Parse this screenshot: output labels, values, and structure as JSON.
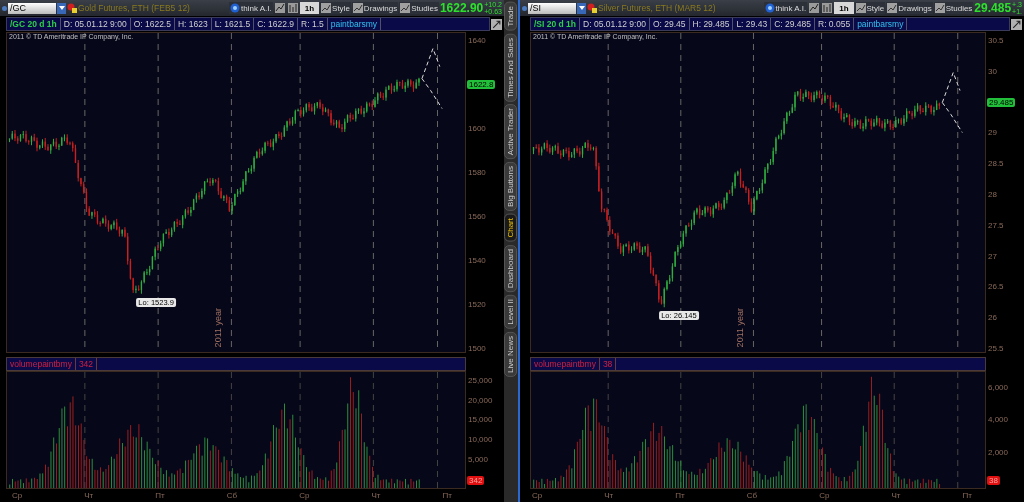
{
  "panels": [
    {
      "symbol": "/GC",
      "description": "Gold Futures, ETH (FEB5 12)",
      "think_ai": "think A.I.",
      "interval": "1h",
      "buttons": [
        "Style",
        "Drawings",
        "Studies"
      ],
      "last_price": "1622.90",
      "change": [
        "+10.2",
        "+0.63"
      ],
      "info": {
        "title": "/GC 20 d 1h",
        "cells": [
          "D: 05.01.12 9:00",
          "O: 1622.5",
          "H: 1623",
          "L: 1621.5",
          "C: 1622.9",
          "R: 1.5"
        ],
        "study": "paintbarsmy"
      },
      "copyright": "2011 © TD Ameritrade IP Company, Inc.",
      "price_axis": [
        {
          "kind": "tick",
          "label": "1640"
        },
        {
          "kind": "badge",
          "label": "1622.8"
        },
        {
          "kind": "tick",
          "label": "1600"
        },
        {
          "kind": "tick",
          "label": "1580"
        },
        {
          "kind": "tick",
          "label": "1560"
        },
        {
          "kind": "tick",
          "label": "1540"
        },
        {
          "kind": "tick",
          "label": "1520"
        },
        {
          "kind": "tick",
          "label": "1500"
        }
      ],
      "low_label": "Lo: 1523.9",
      "year_label": "2011 year",
      "volume": {
        "label": "volumepaintbmy",
        "value": "342",
        "ticks": [
          "25,000",
          "20,000",
          "15,000",
          "10,000",
          "5,000"
        ],
        "badge": "342"
      },
      "x_labels": [
        "Ср",
        "Чт",
        "Пт",
        "Сб",
        "Ср",
        "Чт",
        "Пт"
      ]
    },
    {
      "symbol": "/SI",
      "description": "Silver Futures, ETH (MAR5 12)",
      "think_ai": "think A.I.",
      "interval": "1h",
      "buttons": [
        "Style",
        "Drawings",
        "Studies"
      ],
      "last_price": "29.485",
      "change": [
        "+.3",
        "+1."
      ],
      "info": {
        "title": "/SI 20 d 1h",
        "cells": [
          "D: 05.01.12 9:00",
          "O: 29.45",
          "H: 29.485",
          "L: 29.43",
          "C: 29.485",
          "R: 0.055"
        ],
        "study": "paintbarsmy"
      },
      "copyright": "2011 © TD Ameritrade IP Company, Inc.",
      "price_axis": [
        {
          "kind": "tick",
          "label": "30.5"
        },
        {
          "kind": "tick",
          "label": "30"
        },
        {
          "kind": "badge",
          "label": "29.485"
        },
        {
          "kind": "tick",
          "label": "29"
        },
        {
          "kind": "tick",
          "label": "28.5"
        },
        {
          "kind": "tick",
          "label": "28"
        },
        {
          "kind": "tick",
          "label": "27.5"
        },
        {
          "kind": "tick",
          "label": "27"
        },
        {
          "kind": "tick",
          "label": "26.5"
        },
        {
          "kind": "tick",
          "label": "26"
        },
        {
          "kind": "tick",
          "label": "25.5"
        }
      ],
      "low_label": "Lo: 26.145",
      "year_label": "2011 year",
      "volume": {
        "label": "volumepaintbmy",
        "value": "38",
        "ticks": [
          "6,000",
          "4,000",
          "2,000"
        ],
        "badge": "38"
      },
      "x_labels": [
        "Ср",
        "Чт",
        "Пт",
        "Сб",
        "Ср",
        "Чт",
        "Пт"
      ]
    }
  ],
  "side_tabs": [
    {
      "label": "Trade",
      "selected": false
    },
    {
      "label": "Times And Sales",
      "selected": false
    },
    {
      "label": "Active Trader",
      "selected": false
    },
    {
      "label": "Big Buttons",
      "selected": false
    },
    {
      "label": "Chart",
      "selected": true
    },
    {
      "label": "Dashboard",
      "selected": false
    },
    {
      "label": "Level II",
      "selected": false
    },
    {
      "label": "Live News",
      "selected": false
    }
  ]
}
